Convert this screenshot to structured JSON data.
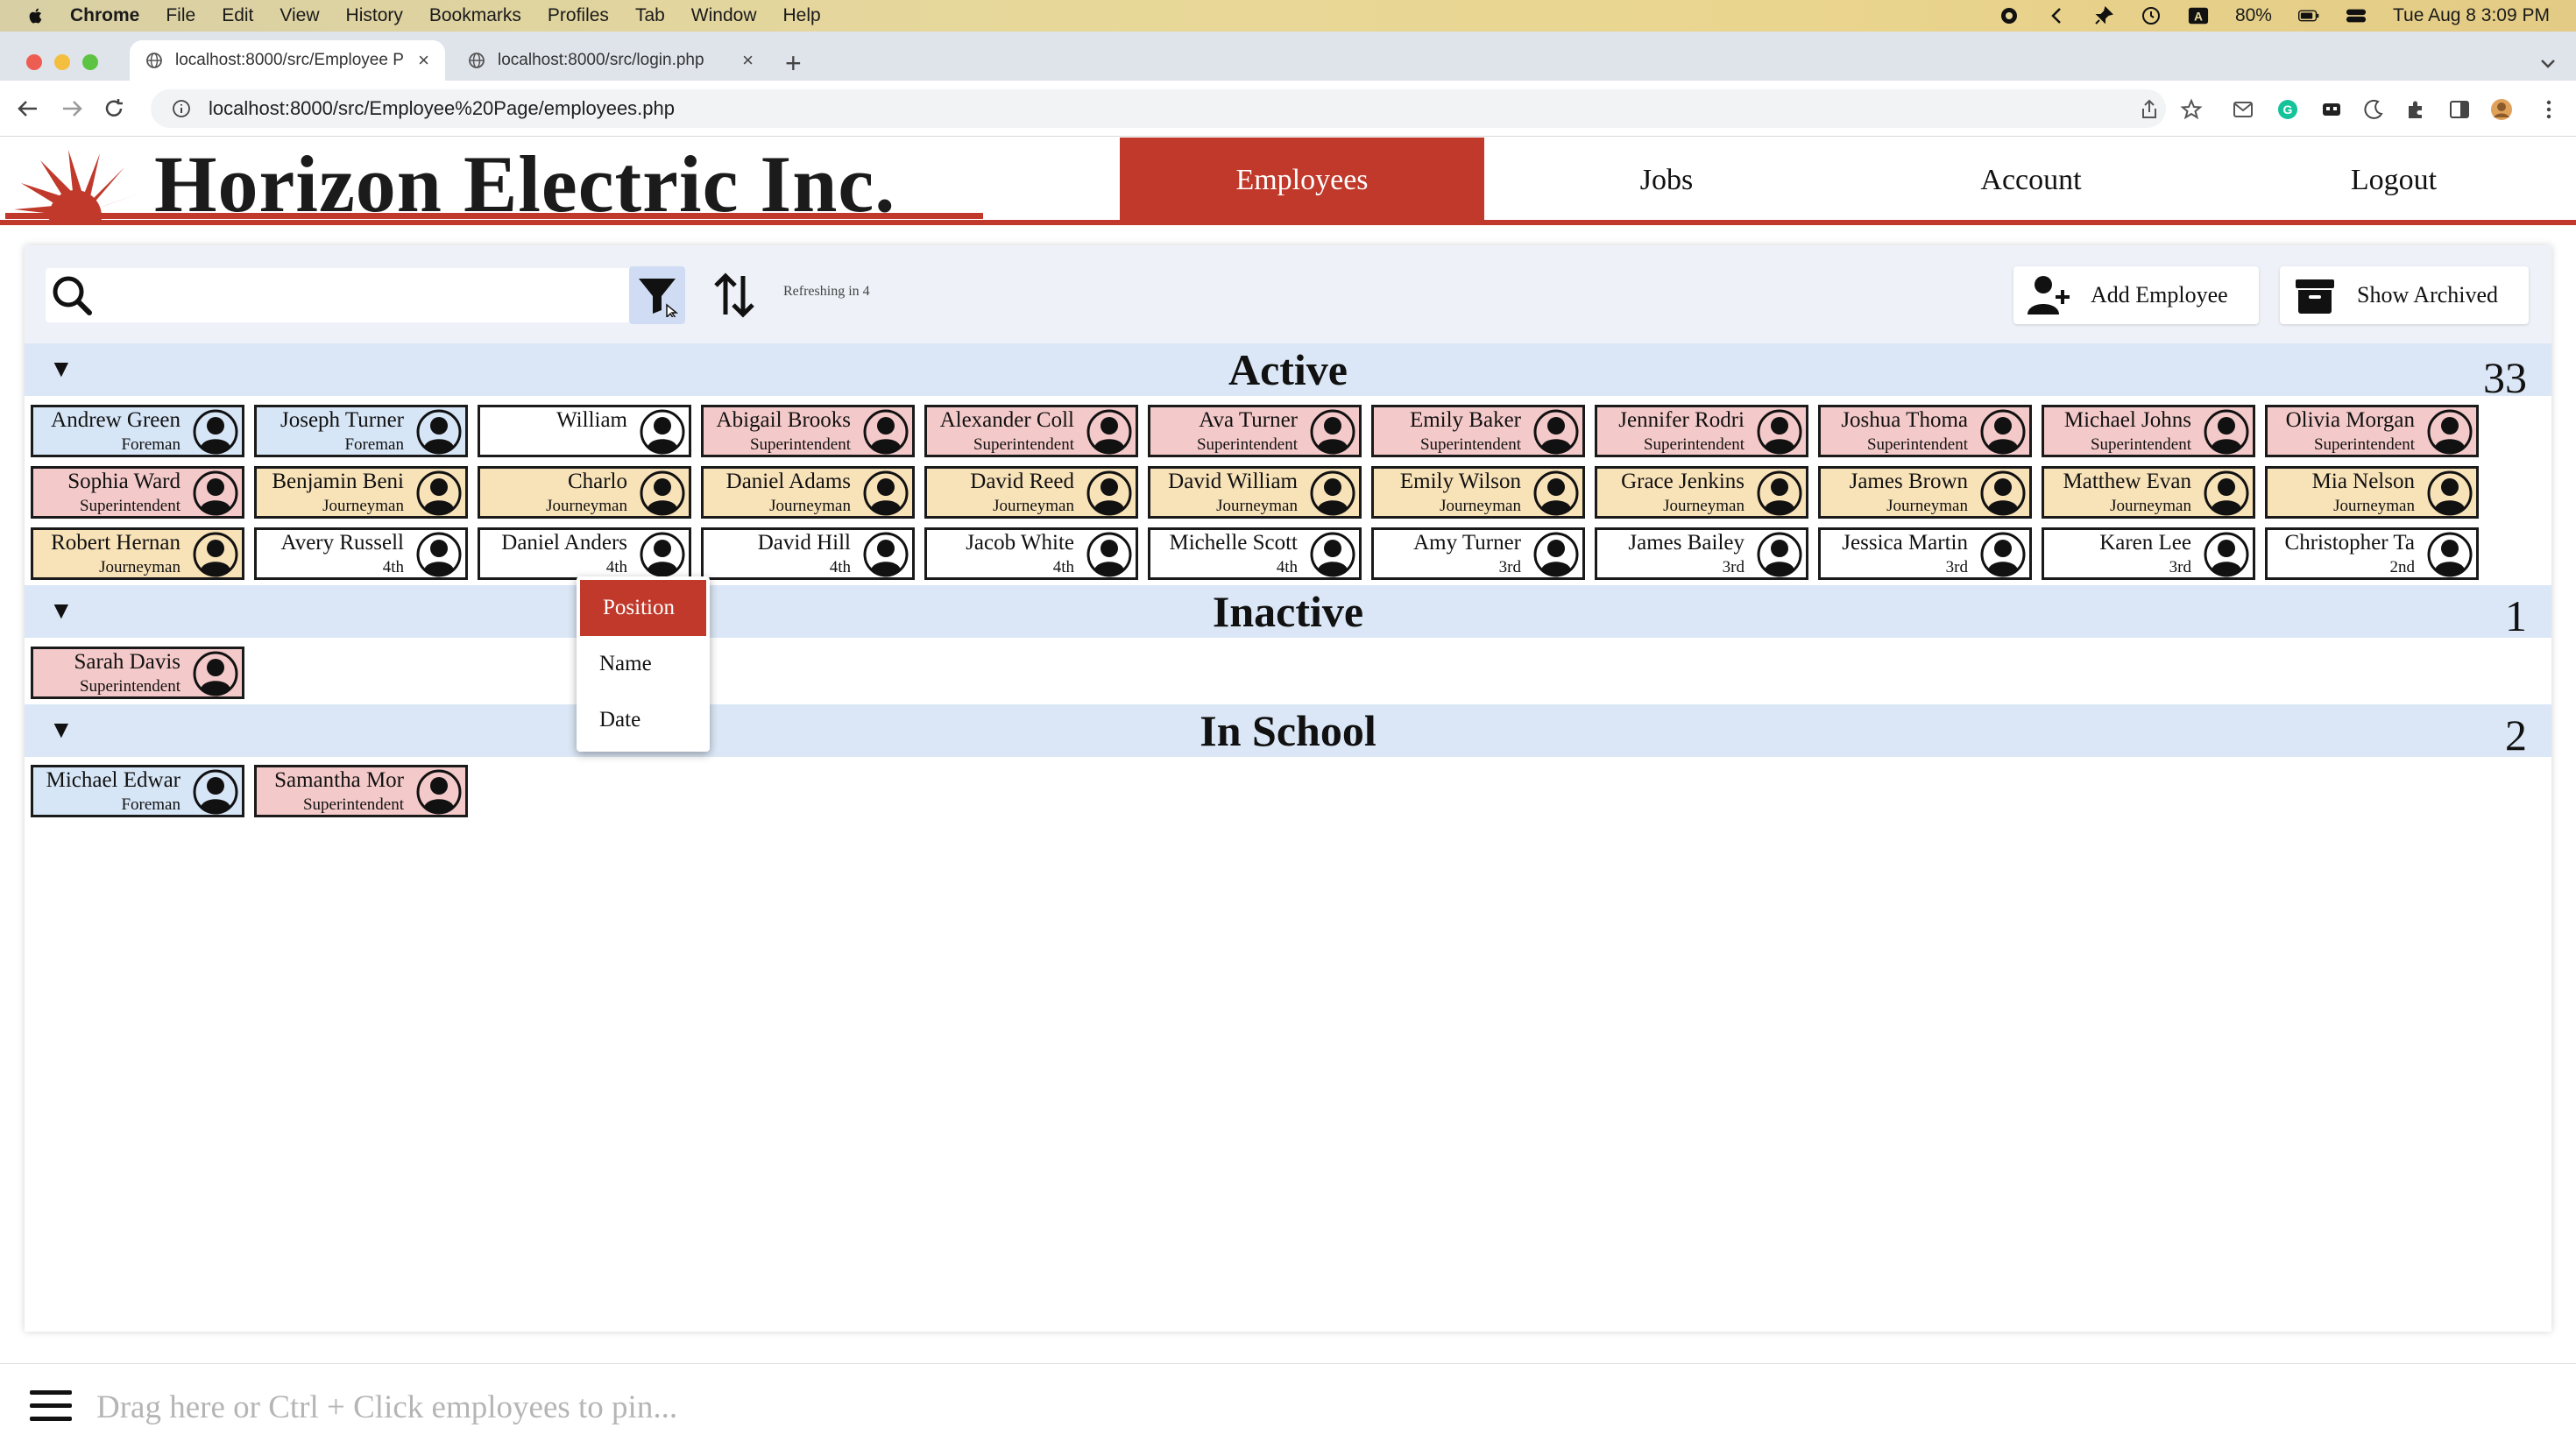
{
  "menubar": {
    "app": "Chrome",
    "items": [
      "File",
      "Edit",
      "View",
      "History",
      "Bookmarks",
      "Profiles",
      "Tab",
      "Window",
      "Help"
    ],
    "battery": "80%",
    "datetime": "Tue Aug 8  3:09 PM"
  },
  "browser": {
    "tabs": [
      {
        "title": "localhost:8000/src/Employee P"
      },
      {
        "title": "localhost:8000/src/login.php"
      }
    ],
    "url": "localhost:8000/src/Employee%20Page/employees.php"
  },
  "header": {
    "company": "Horizon Electric Inc.",
    "nav": [
      "Employees",
      "Jobs",
      "Account",
      "Logout"
    ]
  },
  "toolbar": {
    "search_placeholder": "",
    "refresh_text": "Refreshing in 4",
    "add_employee": "Add Employee",
    "show_archived": "Show Archived"
  },
  "filter_menu": {
    "options": [
      "Position",
      "Name",
      "Date"
    ],
    "selected": "Position"
  },
  "colors": {
    "brand_red": "#c0392b",
    "foreman": "#d7e6f7",
    "superintendent": "#f4c9c9",
    "journeyman": "#f8e2b8",
    "apprentice": "#ffffff",
    "section_bg": "#dbe7f6"
  },
  "sections": {
    "active": {
      "title": "Active",
      "count": "33",
      "rows": [
        [
          {
            "name": "Andrew Green",
            "position": "Foreman"
          },
          {
            "name": "Joseph Turner",
            "position": "Foreman"
          },
          {
            "name": "William",
            "position": ""
          },
          {
            "name": "Abigail Brooks",
            "position": "Superintendent"
          },
          {
            "name": "Alexander Coll",
            "position": "Superintendent"
          },
          {
            "name": "Ava Turner",
            "position": "Superintendent"
          },
          {
            "name": "Emily Baker",
            "position": "Superintendent"
          },
          {
            "name": "Jennifer Rodri",
            "position": "Superintendent"
          },
          {
            "name": "Joshua Thoma",
            "position": "Superintendent"
          },
          {
            "name": "Michael Johns",
            "position": "Superintendent"
          },
          {
            "name": "Olivia Morgan",
            "position": "Superintendent"
          }
        ],
        [
          {
            "name": "Sophia Ward",
            "position": "Superintendent"
          },
          {
            "name": "Benjamin Beni",
            "position": "Journeyman"
          },
          {
            "name": "Charlo",
            "position": "Journeyman"
          },
          {
            "name": "Daniel Adams",
            "position": "Journeyman"
          },
          {
            "name": "David Reed",
            "position": "Journeyman"
          },
          {
            "name": "David William",
            "position": "Journeyman"
          },
          {
            "name": "Emily Wilson",
            "position": "Journeyman"
          },
          {
            "name": "Grace Jenkins",
            "position": "Journeyman"
          },
          {
            "name": "James Brown",
            "position": "Journeyman"
          },
          {
            "name": "Matthew Evan",
            "position": "Journeyman"
          },
          {
            "name": "Mia Nelson",
            "position": "Journeyman"
          }
        ],
        [
          {
            "name": "Robert Hernan",
            "position": "Journeyman"
          },
          {
            "name": "Avery Russell",
            "position": "4th"
          },
          {
            "name": "Daniel Anders",
            "position": "4th"
          },
          {
            "name": "David Hill",
            "position": "4th"
          },
          {
            "name": "Jacob White",
            "position": "4th"
          },
          {
            "name": "Michelle Scott",
            "position": "4th"
          },
          {
            "name": "Amy Turner",
            "position": "3rd"
          },
          {
            "name": "James Bailey",
            "position": "3rd"
          },
          {
            "name": "Jessica Martin",
            "position": "3rd"
          },
          {
            "name": "Karen Lee",
            "position": "3rd"
          },
          {
            "name": "Christopher Ta",
            "position": "2nd"
          }
        ]
      ]
    },
    "inactive": {
      "title": "Inactive",
      "count": "1",
      "cards": [
        {
          "name": "Sarah Davis",
          "position": "Superintendent"
        }
      ]
    },
    "school": {
      "title": "In School",
      "count": "2",
      "cards": [
        {
          "name": "Michael Edwar",
          "position": "Foreman"
        },
        {
          "name": "Samantha Mor",
          "position": "Superintendent"
        }
      ]
    }
  },
  "pinbar": {
    "hint": "Drag here or Ctrl + Click employees to pin..."
  }
}
